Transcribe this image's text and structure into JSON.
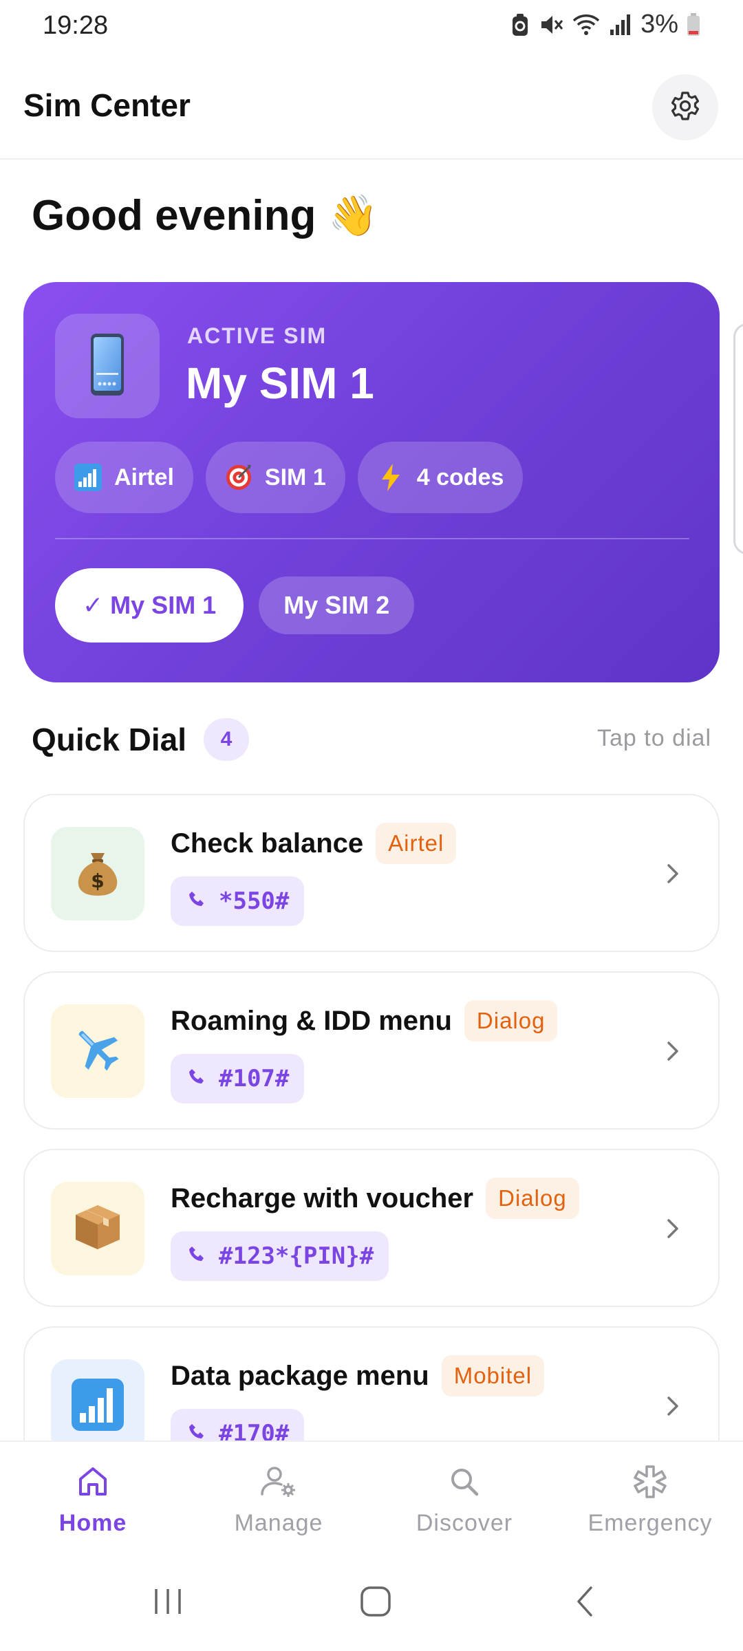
{
  "status_bar": {
    "time": "19:28",
    "battery_percent": "3%"
  },
  "app_bar": {
    "title": "Sim Center",
    "settings_icon": "gear-icon"
  },
  "greeting": {
    "text": "Good evening",
    "emoji": "👋"
  },
  "active_sim": {
    "label": "ACTIVE SIM",
    "name": "My SIM 1",
    "icon": "phone-icon",
    "chips": [
      {
        "icon": "signal-bars-icon",
        "label": "Airtel"
      },
      {
        "icon": "target-icon",
        "label": "SIM 1"
      },
      {
        "icon": "lightning-icon",
        "label": "4 codes"
      }
    ],
    "sim_tabs": [
      {
        "label": "✓ My SIM 1",
        "selected": true
      },
      {
        "label": "My SIM 2",
        "selected": false
      }
    ]
  },
  "quick_dial": {
    "title": "Quick Dial",
    "count": "4",
    "hint": "Tap to dial",
    "items": [
      {
        "title": "Check balance",
        "tag": "Airtel",
        "code": "*550#",
        "icon": "money-bag-icon",
        "icon_bg": "#e8f5ea"
      },
      {
        "title": "Roaming & IDD menu",
        "tag": "Dialog",
        "code": "#107#",
        "icon": "airplane-icon",
        "icon_bg": "#fdf6df"
      },
      {
        "title": "Recharge with voucher",
        "tag": "Dialog",
        "code": "#123*{PIN}#",
        "icon": "package-icon",
        "icon_bg": "#fdf6df"
      },
      {
        "title": "Data package menu",
        "tag": "Mobitel",
        "code": "#170#",
        "icon": "signal-bars-icon",
        "icon_bg": "#e6f1fd"
      }
    ]
  },
  "bottom_nav": {
    "items": [
      {
        "label": "Home",
        "icon": "home-icon",
        "active": true
      },
      {
        "label": "Manage",
        "icon": "user-settings-icon",
        "active": false
      },
      {
        "label": "Discover",
        "icon": "search-icon",
        "active": false
      },
      {
        "label": "Emergency",
        "icon": "asterisk-icon",
        "active": false
      }
    ]
  },
  "colors": {
    "accent": "#7b45e4",
    "card_gradient_start": "#8a4ff0",
    "card_gradient_end": "#5f34c8",
    "tag_text": "#e2620f",
    "tag_bg": "#fdf0e4"
  }
}
